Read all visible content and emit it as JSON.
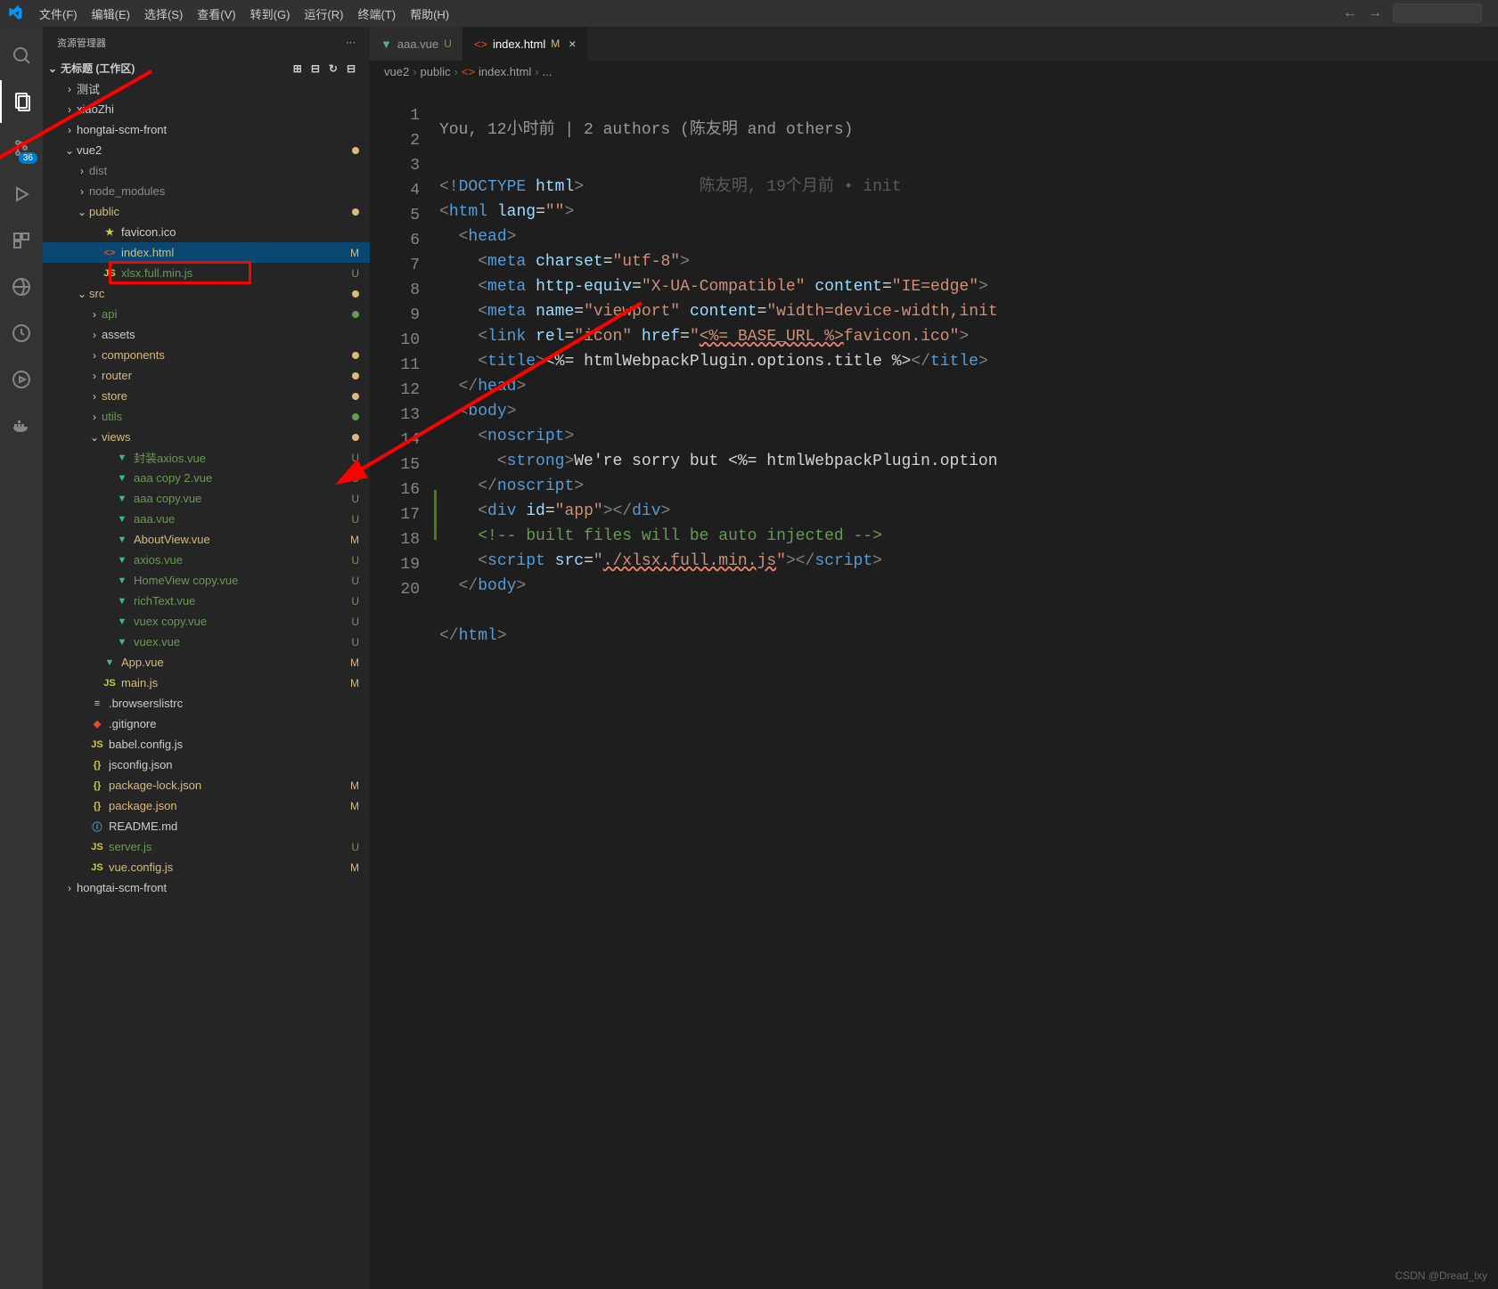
{
  "titlebar": {
    "menus": [
      "文件(F)",
      "编辑(E)",
      "选择(S)",
      "查看(V)",
      "转到(G)",
      "运行(R)",
      "终端(T)",
      "帮助(H)"
    ]
  },
  "activitybar": {
    "badge": "36"
  },
  "sidebar": {
    "header": "资源管理器",
    "workspace": "无标题 (工作区)",
    "tree": [
      {
        "indent": 1,
        "chev": ">",
        "label": "测试",
        "type": "folder"
      },
      {
        "indent": 1,
        "chev": ">",
        "label": "xiaoZhi",
        "type": "folder"
      },
      {
        "indent": 1,
        "chev": ">",
        "label": "hongtai-scm-front",
        "type": "folder"
      },
      {
        "indent": 1,
        "chev": "v",
        "label": "vue2",
        "type": "folder",
        "dot": "M"
      },
      {
        "indent": 2,
        "chev": ">",
        "label": "dist",
        "type": "folder",
        "dim": true
      },
      {
        "indent": 2,
        "chev": ">",
        "label": "node_modules",
        "type": "folder",
        "dim": true
      },
      {
        "indent": 2,
        "chev": "v",
        "label": "public",
        "type": "folder",
        "dot": "M",
        "mod": true
      },
      {
        "indent": 3,
        "icon": "fav",
        "label": "favicon.ico",
        "iconClass": "favicon-icon"
      },
      {
        "indent": 3,
        "icon": "html",
        "label": "index.html",
        "iconClass": "html-icon",
        "status": "M",
        "selected": true,
        "mod": true
      },
      {
        "indent": 3,
        "icon": "js",
        "label": "xlsx.full.min.js",
        "iconClass": "js-icon",
        "status": "U",
        "green": true,
        "boxed": true
      },
      {
        "indent": 2,
        "chev": "v",
        "label": "src",
        "type": "folder",
        "dot": "M",
        "mod": true
      },
      {
        "indent": 3,
        "chev": ">",
        "label": "api",
        "type": "folder",
        "dot": "U",
        "green": true
      },
      {
        "indent": 3,
        "chev": ">",
        "label": "assets",
        "type": "folder"
      },
      {
        "indent": 3,
        "chev": ">",
        "label": "components",
        "type": "folder",
        "dot": "M",
        "mod": true
      },
      {
        "indent": 3,
        "chev": ">",
        "label": "router",
        "type": "folder",
        "dot": "M",
        "mod": true
      },
      {
        "indent": 3,
        "chev": ">",
        "label": "store",
        "type": "folder",
        "dot": "M",
        "mod": true
      },
      {
        "indent": 3,
        "chev": ">",
        "label": "utils",
        "type": "folder",
        "dot": "U",
        "green": true
      },
      {
        "indent": 3,
        "chev": "v",
        "label": "views",
        "type": "folder",
        "dot": "M",
        "mod": true
      },
      {
        "indent": 4,
        "icon": "vue",
        "label": "封装axios.vue",
        "iconClass": "vue-icon",
        "status": "U",
        "green": true
      },
      {
        "indent": 4,
        "icon": "vue",
        "label": "aaa copy 2.vue",
        "iconClass": "vue-icon",
        "status": "U",
        "green": true
      },
      {
        "indent": 4,
        "icon": "vue",
        "label": "aaa copy.vue",
        "iconClass": "vue-icon",
        "status": "U",
        "green": true
      },
      {
        "indent": 4,
        "icon": "vue",
        "label": "aaa.vue",
        "iconClass": "vue-icon",
        "status": "U",
        "green": true
      },
      {
        "indent": 4,
        "icon": "vue",
        "label": "AboutView.vue",
        "iconClass": "vue-icon",
        "status": "M",
        "mod": true
      },
      {
        "indent": 4,
        "icon": "vue",
        "label": "axios.vue",
        "iconClass": "vue-icon",
        "status": "U",
        "green": true
      },
      {
        "indent": 4,
        "icon": "vue",
        "label": "HomeView copy.vue",
        "iconClass": "vue-icon",
        "status": "U",
        "green": true
      },
      {
        "indent": 4,
        "icon": "vue",
        "label": "richText.vue",
        "iconClass": "vue-icon",
        "status": "U",
        "green": true
      },
      {
        "indent": 4,
        "icon": "vue",
        "label": "vuex copy.vue",
        "iconClass": "vue-icon",
        "status": "U",
        "green": true
      },
      {
        "indent": 4,
        "icon": "vue",
        "label": "vuex.vue",
        "iconClass": "vue-icon",
        "status": "U",
        "green": true
      },
      {
        "indent": 3,
        "icon": "vue",
        "label": "App.vue",
        "iconClass": "vue-icon",
        "status": "M",
        "mod": true
      },
      {
        "indent": 3,
        "icon": "js",
        "label": "main.js",
        "iconClass": "js-icon",
        "status": "M",
        "mod": true
      },
      {
        "indent": 2,
        "icon": "txt",
        "label": ".browserslistrc",
        "iconClass": ""
      },
      {
        "indent": 2,
        "icon": "git",
        "label": ".gitignore",
        "iconClass": "git-icon"
      },
      {
        "indent": 2,
        "icon": "js",
        "label": "babel.config.js",
        "iconClass": "js-icon"
      },
      {
        "indent": 2,
        "icon": "json",
        "label": "jsconfig.json",
        "iconClass": "bracket-icon"
      },
      {
        "indent": 2,
        "icon": "json",
        "label": "package-lock.json",
        "iconClass": "bracket-icon",
        "status": "M",
        "mod": true
      },
      {
        "indent": 2,
        "icon": "json",
        "label": "package.json",
        "iconClass": "bracket-icon",
        "status": "M",
        "mod": true
      },
      {
        "indent": 2,
        "icon": "info",
        "label": "README.md",
        "iconClass": "info-icon"
      },
      {
        "indent": 2,
        "icon": "js",
        "label": "server.js",
        "iconClass": "js-icon",
        "status": "U",
        "green": true
      },
      {
        "indent": 2,
        "icon": "js",
        "label": "vue.config.js",
        "iconClass": "js-icon",
        "status": "M",
        "mod": true
      },
      {
        "indent": 1,
        "chev": ">",
        "label": "hongtai-scm-front",
        "type": "folder"
      }
    ]
  },
  "tabs": [
    {
      "icon": "vue",
      "label": "aaa.vue",
      "status": "U",
      "statusClass": "U"
    },
    {
      "icon": "html",
      "label": "index.html",
      "status": "M",
      "statusClass": "M",
      "active": true
    }
  ],
  "breadcrumb": {
    "parts": [
      "vue2",
      "public",
      "index.html",
      "..."
    ],
    "icon_index": 2
  },
  "codelens": "You, 12小时前 | 2 authors (陈友明 and others)",
  "gitlens_line1": "陈友明, 19个月前 • init",
  "code": {
    "lines": [
      "1",
      "2",
      "3",
      "4",
      "5",
      "6",
      "7",
      "8",
      "9",
      "10",
      "11",
      "12",
      "13",
      "14",
      "15",
      "16",
      "17",
      "18",
      "19",
      "20"
    ]
  },
  "watermark": "CSDN @Dread_lxy"
}
